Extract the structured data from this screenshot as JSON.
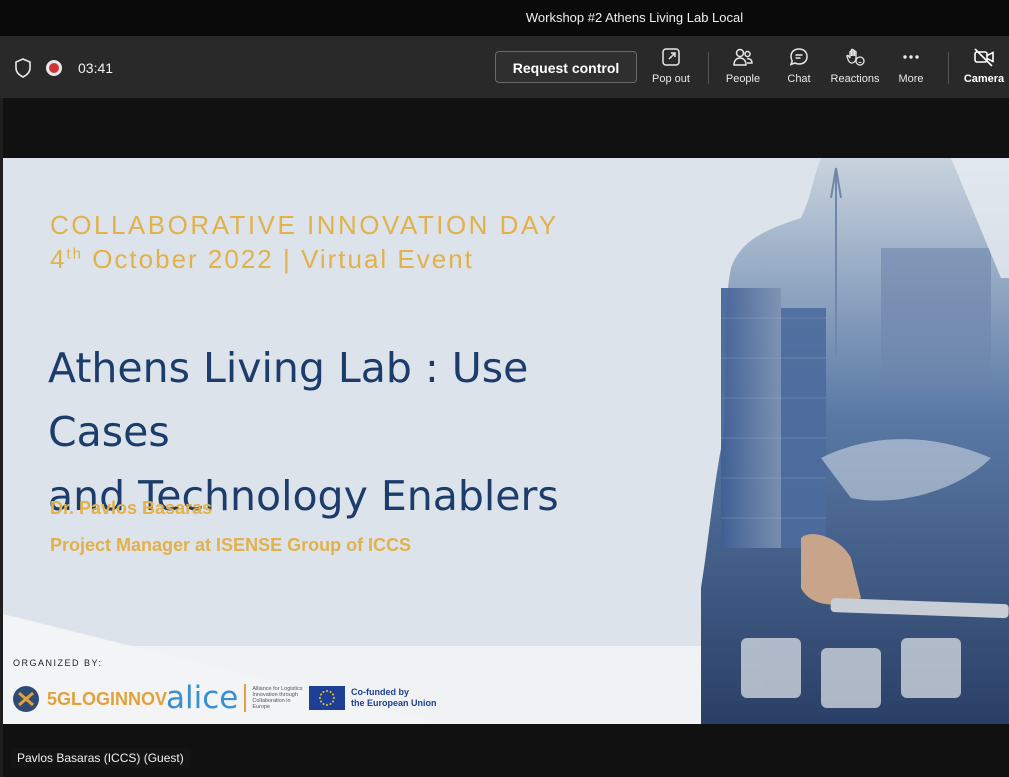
{
  "window": {
    "title": "Workshop #2 Athens Living Lab Local"
  },
  "toolbar": {
    "timer": "03:41",
    "request_control": "Request control",
    "items": [
      {
        "label": "Pop out",
        "icon": "pop-out-icon"
      },
      {
        "label": "People",
        "icon": "people-icon"
      },
      {
        "label": "Chat",
        "icon": "chat-icon"
      },
      {
        "label": "Reactions",
        "icon": "reactions-icon"
      },
      {
        "label": "More",
        "icon": "more-icon"
      },
      {
        "label": "Camera",
        "icon": "camera-off-icon"
      }
    ]
  },
  "slide": {
    "event_title": "COLLABORATIVE INNOVATION DAY",
    "date_day": "4",
    "date_suffix": "th",
    "date_rest": " October 2022 | Virtual Event",
    "main_title_line1": "Athens Living Lab : Use Cases",
    "main_title_line2": "and Technology Enablers",
    "presenter": "Dr. Pavlos Basaras",
    "role": "Project Manager at ISENSE Group of ICCS",
    "organized_by": "ORGANIZED BY:",
    "logo_5g": "5GLOGINNOV",
    "logo_alice": "alice",
    "logo_alice_sub": "Alliance for Logistics Innovation through Collaboration in Europe",
    "logo_eu_line1": "Co-funded by",
    "logo_eu_line2": "the European Union"
  },
  "participant": {
    "name": "Pavlos Basaras (ICCS) (Guest)"
  },
  "colors": {
    "accent_gold": "#e2b14a",
    "title_blue": "#1c3d6b",
    "toolbar_bg": "#292929"
  }
}
